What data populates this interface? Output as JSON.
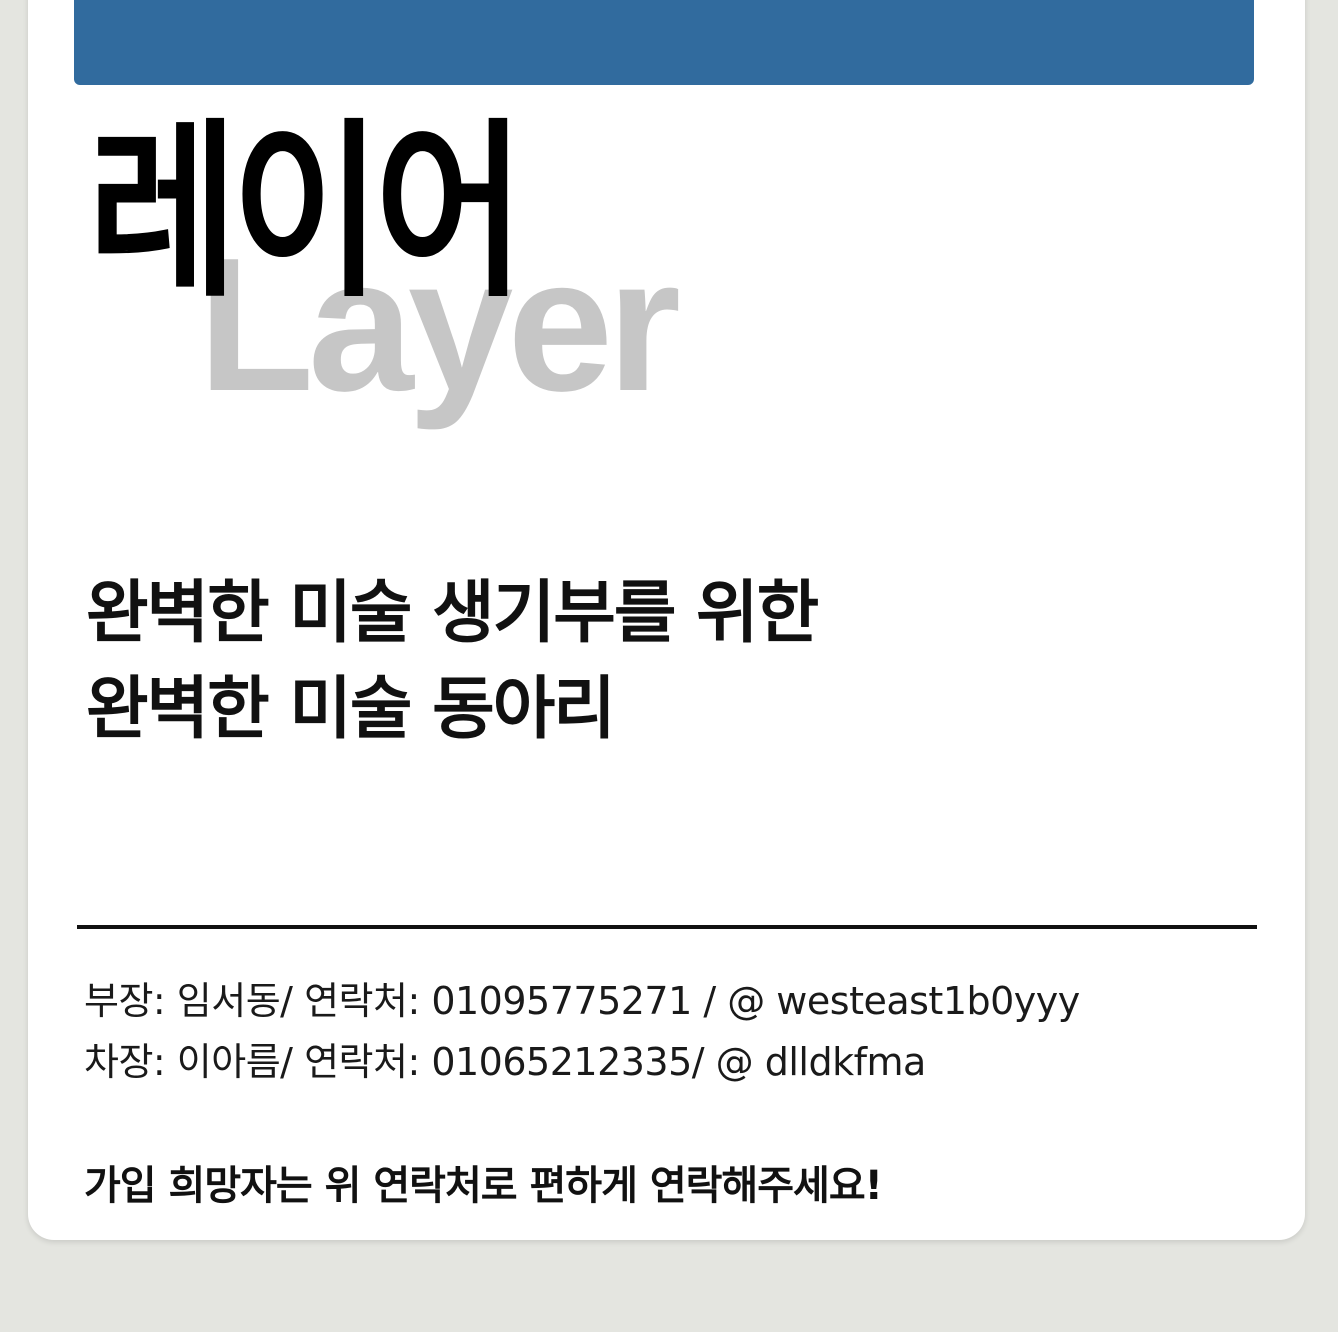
{
  "colors": {
    "background": "#e4e5e0",
    "card": "#ffffff",
    "banner": "#316b9e",
    "title_primary": "#000000",
    "title_secondary": "#c6c6c6",
    "text": "#111111"
  },
  "poster": {
    "title_ko": "레이어",
    "title_en": "Layer",
    "tagline": [
      "완벽한 미술 생기부를 위한",
      "완벽한 미술 동아리"
    ],
    "contacts": [
      "부장: 임서동/ 연락처: 01095775271 / @ westeast1b0yyy",
      "차장: 이아름/ 연락처: 01065212335/ @ dlldkfma"
    ],
    "join_note": "가입 희망자는 위 연락처로 편하게 연락해주세요!"
  }
}
